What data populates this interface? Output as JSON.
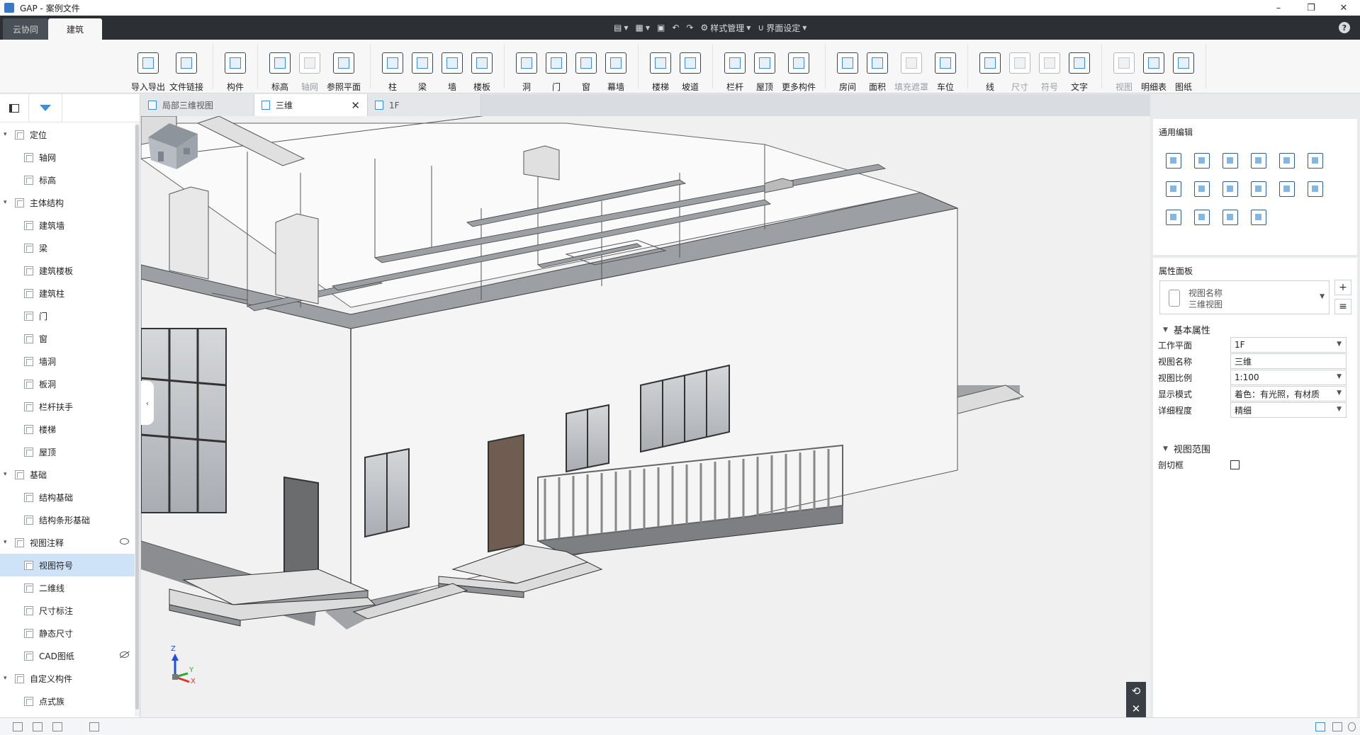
{
  "window": {
    "title": "GAP - 案例文件",
    "controls": [
      "–",
      "❐",
      "✕"
    ]
  },
  "ribbon_tabs": {
    "cloud": "云协同",
    "active": "建筑"
  },
  "quick_access": {
    "style_mgmt": "样式管理",
    "ui_settings": "界面设定",
    "help": "?"
  },
  "ribbon": {
    "groups": [
      {
        "buttons": [
          {
            "label": "导入导出",
            "icon": "cad-import-icon"
          },
          {
            "label": "文件链接",
            "icon": "file-link-icon"
          }
        ]
      },
      {
        "buttons": [
          {
            "label": "构件",
            "icon": "component-icon"
          }
        ]
      },
      {
        "buttons": [
          {
            "label": "标高",
            "icon": "level-icon"
          },
          {
            "label": "轴网",
            "icon": "grid-icon",
            "disabled": true
          },
          {
            "label": "参照平面",
            "icon": "ref-plane-icon"
          }
        ]
      },
      {
        "buttons": [
          {
            "label": "柱",
            "icon": "column-icon"
          },
          {
            "label": "梁",
            "icon": "beam-icon"
          },
          {
            "label": "墙",
            "icon": "wall-icon"
          },
          {
            "label": "楼板",
            "icon": "slab-icon"
          }
        ]
      },
      {
        "buttons": [
          {
            "label": "洞",
            "icon": "opening-icon"
          },
          {
            "label": "门",
            "icon": "door-icon"
          },
          {
            "label": "窗",
            "icon": "window-icon"
          },
          {
            "label": "幕墙",
            "icon": "curtain-wall-icon"
          }
        ]
      },
      {
        "buttons": [
          {
            "label": "楼梯",
            "icon": "stair-icon"
          },
          {
            "label": "坡道",
            "icon": "ramp-icon"
          }
        ]
      },
      {
        "buttons": [
          {
            "label": "栏杆",
            "icon": "railing-icon"
          },
          {
            "label": "屋顶",
            "icon": "roof-icon"
          },
          {
            "label": "更多构件",
            "icon": "more-components-icon"
          }
        ]
      },
      {
        "buttons": [
          {
            "label": "房间",
            "icon": "room-icon"
          },
          {
            "label": "面积",
            "icon": "area-icon"
          },
          {
            "label": "填充遮罩",
            "icon": "fill-mask-icon",
            "disabled": true
          },
          {
            "label": "车位",
            "icon": "parking-icon"
          }
        ]
      },
      {
        "buttons": [
          {
            "label": "线",
            "icon": "line-icon"
          },
          {
            "label": "尺寸",
            "icon": "dimension-icon",
            "disabled": true
          },
          {
            "label": "符号",
            "icon": "symbol-icon",
            "disabled": true
          },
          {
            "label": "文字",
            "icon": "text-icon"
          }
        ]
      },
      {
        "buttons": [
          {
            "label": "视图",
            "icon": "view-icon",
            "disabled": true
          },
          {
            "label": "明细表",
            "icon": "schedule-icon"
          },
          {
            "label": "图纸",
            "icon": "sheet-icon"
          }
        ]
      }
    ]
  },
  "tree": [
    {
      "label": "定位",
      "level": 0,
      "expanded": true
    },
    {
      "label": "轴网",
      "level": 1
    },
    {
      "label": "标高",
      "level": 1
    },
    {
      "label": "主体结构",
      "level": 0,
      "expanded": true
    },
    {
      "label": "建筑墙",
      "level": 1
    },
    {
      "label": "梁",
      "level": 1
    },
    {
      "label": "建筑楼板",
      "level": 1
    },
    {
      "label": "建筑柱",
      "level": 1
    },
    {
      "label": "门",
      "level": 1
    },
    {
      "label": "窗",
      "level": 1
    },
    {
      "label": "墙洞",
      "level": 1
    },
    {
      "label": "板洞",
      "level": 1
    },
    {
      "label": "栏杆扶手",
      "level": 1
    },
    {
      "label": "楼梯",
      "level": 1
    },
    {
      "label": "屋顶",
      "level": 1
    },
    {
      "label": "基础",
      "level": 0,
      "expanded": true
    },
    {
      "label": "结构基础",
      "level": 1
    },
    {
      "label": "结构条形基础",
      "level": 1
    },
    {
      "label": "视图注释",
      "level": 0,
      "expanded": true,
      "eye": "visible"
    },
    {
      "label": "视图符号",
      "level": 1,
      "selected": true
    },
    {
      "label": "二维线",
      "level": 1
    },
    {
      "label": "尺寸标注",
      "level": 1
    },
    {
      "label": "静态尺寸",
      "level": 1
    },
    {
      "label": "CAD图纸",
      "level": 1,
      "eye": "hidden"
    },
    {
      "label": "自定义构件",
      "level": 0,
      "expanded": true
    },
    {
      "label": "点式族",
      "level": 1
    }
  ],
  "doc_tabs": [
    {
      "label": "局部三维视图",
      "active": false
    },
    {
      "label": "三维",
      "active": true,
      "closable": true
    },
    {
      "label": "1F",
      "active": false
    }
  ],
  "viewport": {
    "axis_labels": {
      "z": "Z",
      "y": "Y",
      "x": "X"
    },
    "nav_rotate": "⟲",
    "nav_close": "✕"
  },
  "edit_panel": {
    "title": "通用编辑"
  },
  "properties": {
    "title": "属性面板",
    "type_line1": "视图名称",
    "type_line2": "三维视图",
    "basic_section": "基本属性",
    "rows": [
      {
        "label": "工作平面",
        "value": "1F",
        "dropdown": true
      },
      {
        "label": "视图名称",
        "value": "三维",
        "dropdown": false
      },
      {
        "label": "视图比例",
        "value": "1:100",
        "dropdown": true
      },
      {
        "label": "显示模式",
        "value": "着色：有光照，有材质",
        "dropdown": true
      },
      {
        "label": "详细程度",
        "value": "精细",
        "dropdown": true
      }
    ],
    "range_section": "视图范围",
    "cut_box_label": "剖切框",
    "cut_box_checked": false
  }
}
